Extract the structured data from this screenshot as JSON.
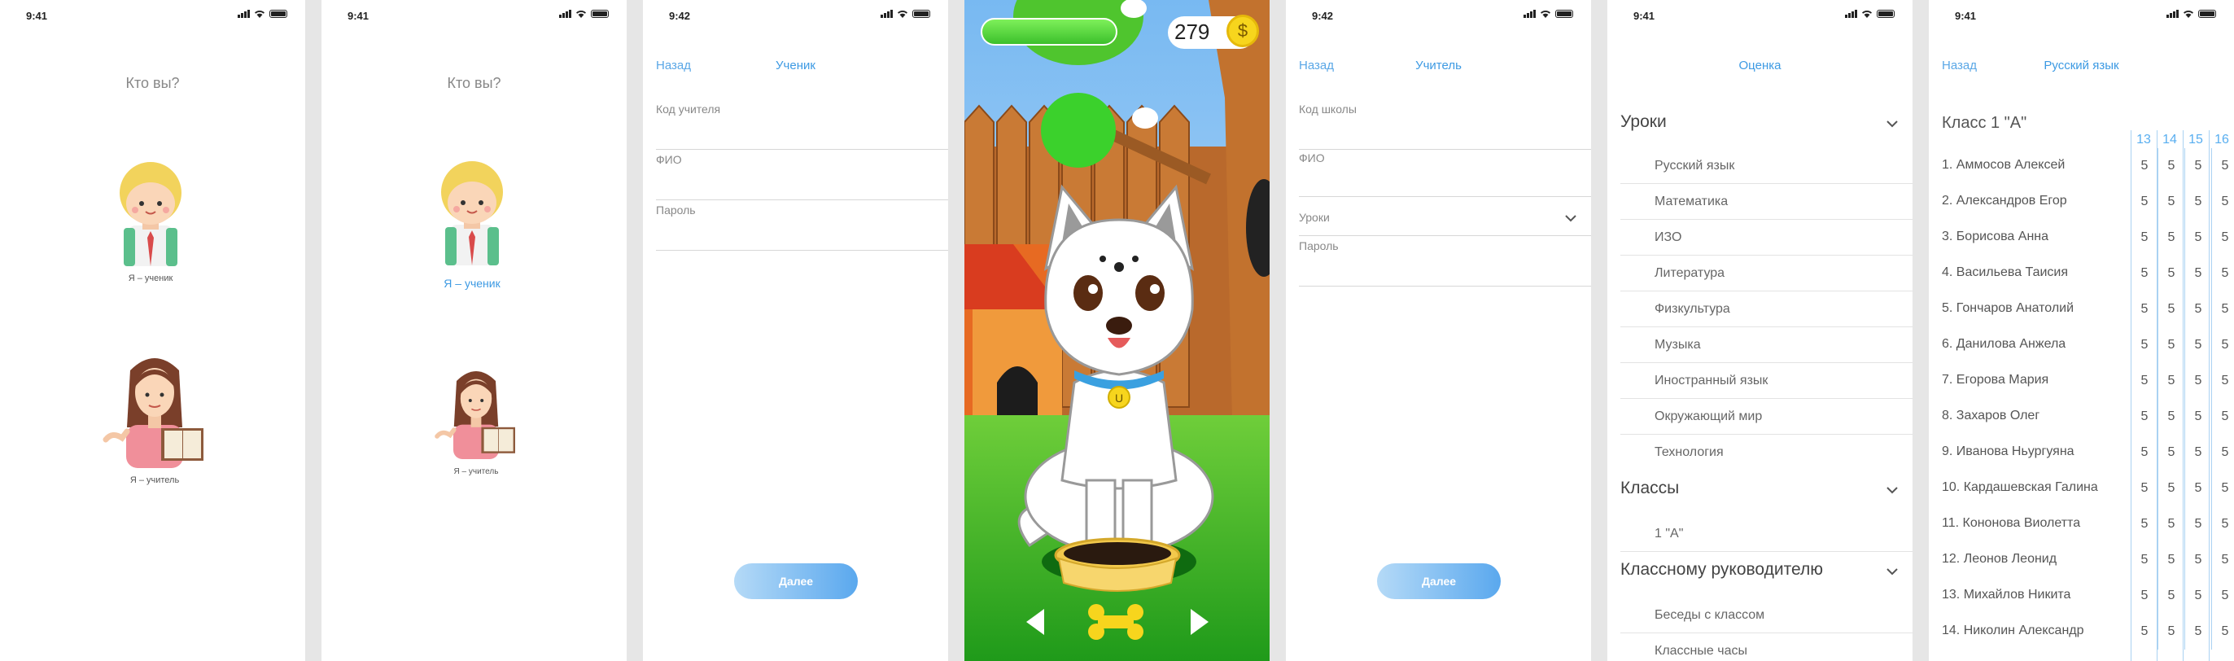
{
  "screens": {
    "s1": {
      "time": "9:41",
      "title": "Кто вы?",
      "student_label": "Я – ученик",
      "teacher_label": "Я – учитель"
    },
    "s2": {
      "time": "9:41",
      "title": "Кто вы?",
      "student_label": "Я – ученик",
      "teacher_label": "Я – учитель"
    },
    "s3": {
      "time": "9:42",
      "back": "Назад",
      "title": "Ученик",
      "fields": [
        "Код учителя",
        "ФИО",
        "Пароль"
      ],
      "next": "Далее"
    },
    "s4": {
      "coins": "279",
      "coin_symbol": "$",
      "tag_letter": "U"
    },
    "s5": {
      "time": "9:42",
      "back": "Назад",
      "title": "Учитель",
      "fields": [
        "Код школы",
        "ФИО",
        "Уроки",
        "Пароль"
      ],
      "next": "Далее"
    },
    "s6": {
      "time": "9:41",
      "title": "Оценка",
      "sections": [
        {
          "title": "Уроки",
          "items": [
            "Русский язык",
            "Математика",
            "ИЗО",
            "Литература",
            "Физкультура",
            "Музыка",
            "Иностранный язык",
            "Окружающий мир",
            "Технология"
          ]
        },
        {
          "title": "Классы",
          "items": [
            "1 \"А\""
          ]
        },
        {
          "title": "Классному руководителю",
          "items": [
            "Беседы с классом",
            "Классные часы"
          ]
        }
      ]
    },
    "s7": {
      "time": "9:41",
      "back": "Назад",
      "title": "Русский язык",
      "class_title": "Класс 1 \"А\"",
      "dates": [
        "13",
        "14",
        "15",
        "16"
      ],
      "students": [
        {
          "name": "1. Аммосов Алексей",
          "grades": [
            "5",
            "5",
            "5",
            "5"
          ]
        },
        {
          "name": "2. Александров Егор",
          "grades": [
            "5",
            "5",
            "5",
            "5"
          ]
        },
        {
          "name": "3. Борисова Анна",
          "grades": [
            "5",
            "5",
            "5",
            "5"
          ]
        },
        {
          "name": "4. Васильева Таисия",
          "grades": [
            "5",
            "5",
            "5",
            "5"
          ]
        },
        {
          "name": "5. Гончаров Анатолий",
          "grades": [
            "5",
            "5",
            "5",
            "5"
          ]
        },
        {
          "name": "6. Данилова Анжела",
          "grades": [
            "5",
            "5",
            "5",
            "5"
          ]
        },
        {
          "name": "7. Егорова Мария",
          "grades": [
            "5",
            "5",
            "5",
            "5"
          ]
        },
        {
          "name": "8. Захаров Олег",
          "grades": [
            "5",
            "5",
            "5",
            "5"
          ]
        },
        {
          "name": "9. Иванова Ньургуяна",
          "grades": [
            "5",
            "5",
            "5",
            "5"
          ]
        },
        {
          "name": "10. Кардашевская Галина",
          "grades": [
            "5",
            "5",
            "5",
            "5"
          ]
        },
        {
          "name": "11. Кононова Виолетта",
          "grades": [
            "5",
            "5",
            "5",
            "5"
          ]
        },
        {
          "name": "12. Леонов Леонид",
          "grades": [
            "5",
            "5",
            "5",
            "5"
          ]
        },
        {
          "name": "13. Михайлов Никита",
          "grades": [
            "5",
            "5",
            "5",
            "5"
          ]
        },
        {
          "name": "14. Николин Александр",
          "grades": [
            "5",
            "5",
            "5",
            "5"
          ]
        }
      ]
    }
  },
  "colors": {
    "accent": "#3d9ae3",
    "grid": "#aad2f2",
    "muted": "#888888"
  }
}
